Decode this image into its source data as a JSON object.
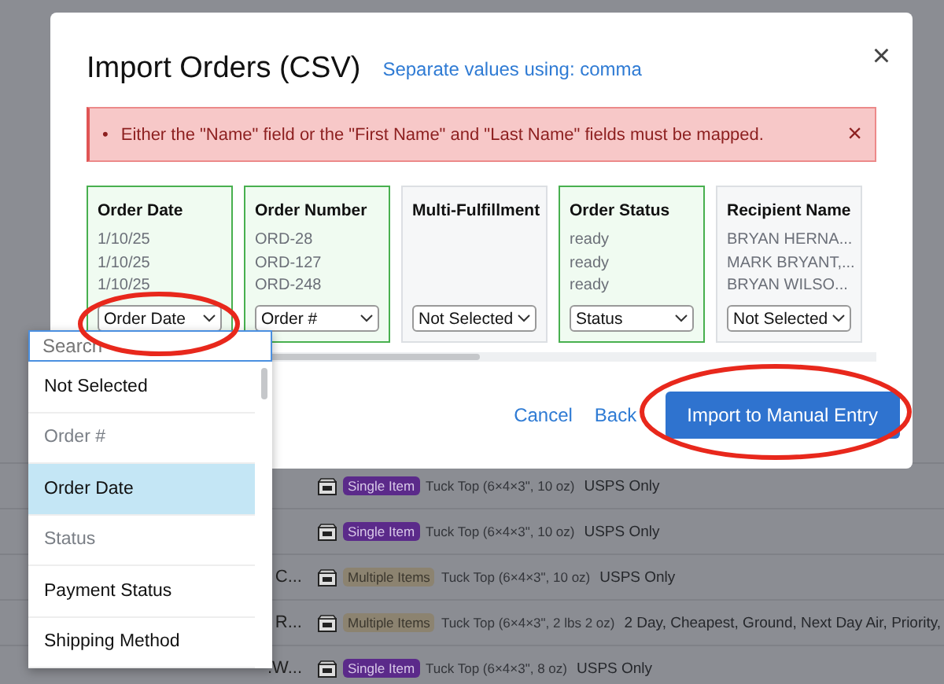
{
  "background_rows": [
    {
      "name": "",
      "badge": {
        "label": "Single Item",
        "kind": "single"
      },
      "package": "Tuck Top (6×4×3\", 10 oz)",
      "service": "USPS Only"
    },
    {
      "name": "",
      "badge": {
        "label": "Single Item",
        "kind": "single"
      },
      "package": "Tuck Top (6×4×3\", 10 oz)",
      "service": "USPS Only"
    },
    {
      "name": "C...",
      "badge": {
        "label": "Multiple Items",
        "kind": "multiple"
      },
      "package": "Tuck Top (6×4×3\", 10 oz)",
      "service": "USPS Only"
    },
    {
      "name": "R...",
      "badge": {
        "label": "Multiple Items",
        "kind": "multiple"
      },
      "package": "Tuck Top (6×4×3\", 2 lbs 2 oz)",
      "service": "2 Day, Cheapest, Ground, Next Day Air, Priority,"
    },
    {
      "name": ".W...",
      "badge": {
        "label": "Single Item",
        "kind": "single"
      },
      "package": "Tuck Top (6×4×3\", 8 oz)",
      "service": "USPS Only"
    }
  ],
  "modal": {
    "title": "Import Orders (CSV)",
    "separator_link": "Separate values using: comma",
    "close": "×",
    "error": {
      "bullet": "•",
      "message": "Either the \"Name\" field or the \"First Name\" and \"Last Name\" fields must be mapped.",
      "dismiss": "×"
    },
    "columns": [
      {
        "header": "Order Date",
        "mapped": true,
        "samples": [
          "1/10/25",
          "1/10/25",
          "1/10/25"
        ],
        "select": "Order Date"
      },
      {
        "header": "Order Number",
        "mapped": true,
        "samples": [
          "ORD-28",
          "ORD-127",
          "ORD-248"
        ],
        "select": "Order #"
      },
      {
        "header": "Multi-Fulfillment",
        "mapped": false,
        "select": "Not Selected"
      },
      {
        "header": "Order Status",
        "mapped": true,
        "samples": [
          "ready",
          "ready",
          "ready"
        ],
        "select": "Status"
      },
      {
        "header": "Recipient Name",
        "mapped": false,
        "samples": [
          "BRYAN HERNA...",
          "MARK BRYANT,...",
          "BRYAN WILSO..."
        ],
        "select": "Not Selected"
      }
    ],
    "buttons": {
      "cancel": "Cancel",
      "back": "Back",
      "import": "Import to Manual Entry"
    }
  },
  "dropdown": {
    "search": {
      "placeholder": "Search"
    },
    "options": [
      {
        "label": "Not Selected",
        "selected": false,
        "disabled": false
      },
      {
        "label": "Order #",
        "selected": false,
        "disabled": true
      },
      {
        "label": "Order Date",
        "selected": true,
        "disabled": false
      },
      {
        "label": "Status",
        "selected": false,
        "disabled": true
      },
      {
        "label": "Payment Status",
        "selected": false,
        "disabled": false
      },
      {
        "label": "Shipping Method",
        "selected": false,
        "disabled": false
      }
    ]
  }
}
